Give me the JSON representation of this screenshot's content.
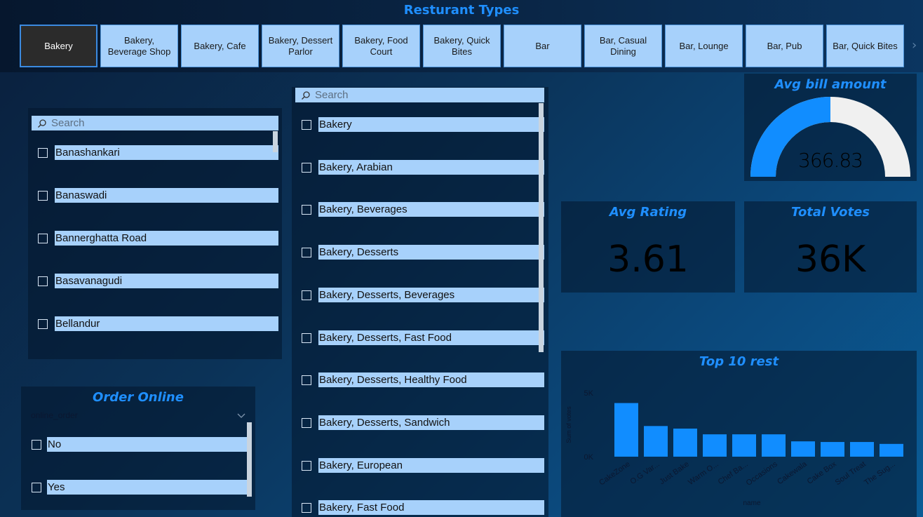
{
  "header": {
    "title": "Resturant Types",
    "tiles": [
      "Bakery",
      "Bakery, Beverage Shop",
      "Bakery, Cafe",
      "Bakery, Dessert Parlor",
      "Bakery, Food Court",
      "Bakery, Quick Bites",
      "Bar",
      "Bar, Casual Dining",
      "Bar, Lounge",
      "Bar, Pub",
      "Bar, Quick Bites"
    ],
    "active_tile": "Bakery",
    "next_icon": "chevron-right-icon"
  },
  "location_slicer": {
    "search_placeholder": "Search",
    "items": [
      "Banashankari",
      "Banaswadi",
      "Bannerghatta Road",
      "Basavanagudi",
      "Bellandur"
    ]
  },
  "cuisine_slicer": {
    "search_placeholder": "Search",
    "items": [
      "Bakery",
      "Bakery, Arabian",
      "Bakery, Beverages",
      "Bakery, Desserts",
      "Bakery, Desserts, Beverages",
      "Bakery, Desserts, Fast Food",
      "Bakery, Desserts, Healthy Food",
      "Bakery, Desserts, Sandwich",
      "Bakery, European",
      "Bakery, Fast Food"
    ]
  },
  "order_online": {
    "title": "Order Online",
    "field": "online_order",
    "items": [
      "No",
      "Yes"
    ]
  },
  "avg_bill": {
    "title": "Avg bill amount",
    "value": "366.83",
    "fill_fraction": 0.5,
    "fill_color": "#118dff",
    "track_color": "#f0f0f0"
  },
  "avg_rating": {
    "title": "Avg Rating",
    "value": "3.61"
  },
  "total_votes": {
    "title": "Total Votes",
    "value": "36K"
  },
  "chart_data": {
    "type": "bar",
    "title": "Top 10 rest",
    "xlabel": "name",
    "ylabel": "Sum of votes",
    "ylim": [
      0,
      5000
    ],
    "yticks": [
      {
        "v": 0,
        "label": "0K"
      },
      {
        "v": 5000,
        "label": "5K"
      }
    ],
    "categories": [
      "CakeZone",
      "O.G Var...",
      "Just Bake",
      "Warm O...",
      "Chef Ba...",
      "Occasions",
      "Cakewala",
      "Cake Box",
      "Soul Treat",
      "The Sug..."
    ],
    "values": [
      4200,
      2400,
      2200,
      1750,
      1750,
      1750,
      1200,
      1150,
      1150,
      1000
    ],
    "bar_color": "#118dff"
  }
}
